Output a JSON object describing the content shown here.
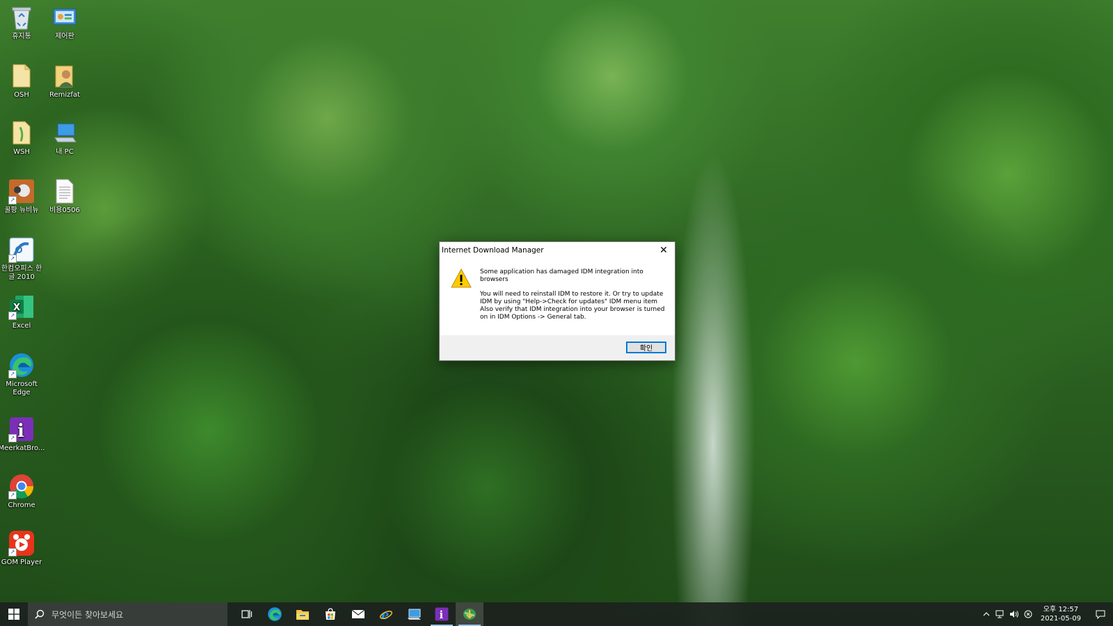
{
  "desktop_icons": [
    {
      "label": "휴지통",
      "icon": "recycle-bin-icon"
    },
    {
      "label": "제어판",
      "icon": "control-panel-icon"
    },
    {
      "label": "OSH",
      "icon": "folder-icon"
    },
    {
      "label": "Remizfat",
      "icon": "user-folder-icon"
    },
    {
      "label": "WSH",
      "icon": "folder-icon"
    },
    {
      "label": "내 PC",
      "icon": "this-pc-icon"
    },
    {
      "label": "꿀팡 뉴비뉴",
      "icon": "app-shortcut-icon"
    },
    {
      "label": "비용0506",
      "icon": "text-file-icon"
    },
    {
      "label": "한컴오피스 한글 2010",
      "icon": "hancom-office-icon"
    },
    {
      "label": "Excel",
      "icon": "excel-icon"
    },
    {
      "label": "Microsoft Edge",
      "icon": "edge-icon"
    },
    {
      "label": "MeerkatBro...",
      "icon": "meerkat-browser-icon"
    },
    {
      "label": "Chrome",
      "icon": "chrome-icon"
    },
    {
      "label": "GOM Player",
      "icon": "gom-player-icon"
    }
  ],
  "dialog": {
    "title": "Internet Download Manager",
    "message_1": "Some application has damaged IDM integration into browsers",
    "message_2": "You will need to reinstall IDM to restore it. Or try to update IDM by using \"Help->Check for updates\" IDM menu item Also verify that IDM integration into your browser is turned on in IDM Options -> General tab.",
    "ok_label": "확인",
    "close_glyph": "✕"
  },
  "taskbar": {
    "search_placeholder": "무엇이든 찾아보세요",
    "pinned": [
      "task-view",
      "edge",
      "file-explorer",
      "microsoft-store",
      "mail",
      "internet-explorer",
      "remote-desktop",
      "meerkat-browser",
      "idm"
    ],
    "active_app": "idm",
    "clock": {
      "time": "오후 12:57",
      "date": "2021-05-09"
    }
  },
  "colors": {
    "accent": "#0078d7",
    "taskbar": "#1c221e"
  }
}
